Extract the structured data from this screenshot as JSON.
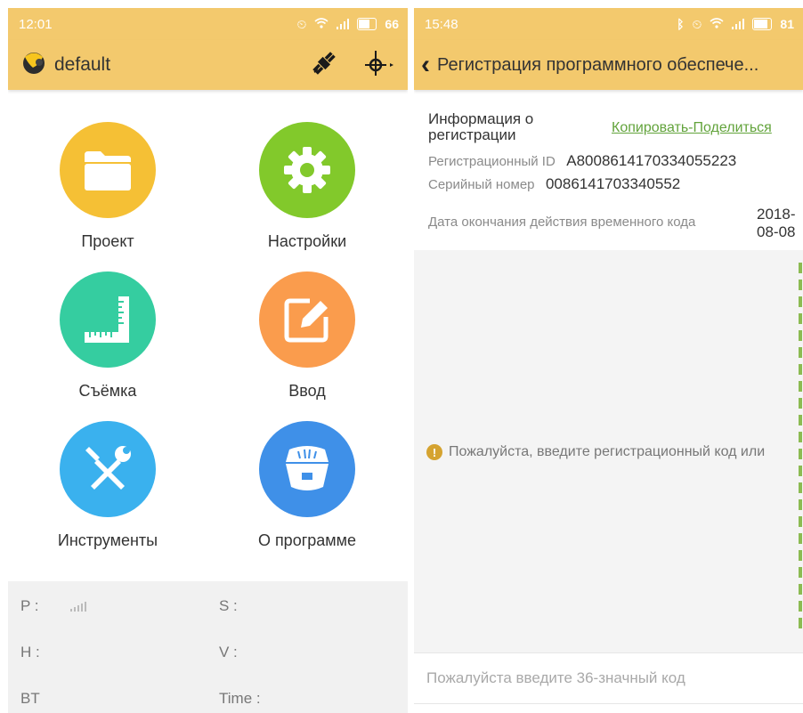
{
  "left_screen": {
    "status": {
      "time": "12:01",
      "battery": "66"
    },
    "app_bar": {
      "title": "default",
      "icons": [
        "satellite-icon",
        "gps-target-icon"
      ]
    },
    "menu": [
      {
        "label": "Проект",
        "icon": "folder-icon",
        "color": "#f5c035"
      },
      {
        "label": "Настройки",
        "icon": "gear-icon",
        "color": "#82c92b"
      },
      {
        "label": "Съёмка",
        "icon": "ruler-survey-icon",
        "color": "#35cda0"
      },
      {
        "label": "Ввод",
        "icon": "edit-icon",
        "color": "#fa9c4d"
      },
      {
        "label": "Инструменты",
        "icon": "tools-icon",
        "color": "#3ab1ee"
      },
      {
        "label": "О программе",
        "icon": "receiver-icon",
        "color": "#3f90e8"
      }
    ],
    "status_panel": {
      "p": "P :",
      "s": "S :",
      "h": "H :",
      "v": "V :",
      "bt": "BT",
      "time": "Time :"
    }
  },
  "right_screen": {
    "status": {
      "time": "15:48",
      "battery": "81"
    },
    "app_bar": {
      "back": "‹",
      "title": "Регистрация программного обеспече..."
    },
    "info": {
      "title": "Информация о регистрации",
      "copy_link": "Копировать-Поделиться",
      "reg_id_label": "Регистрационный ID",
      "reg_id_value": "A8008614170334055223",
      "serial_label": "Серийный номер",
      "serial_value": "0086141703340552",
      "expiry_label": "Дата окончания действия временного кода",
      "expiry_value_1": "2018-",
      "expiry_value_2": "08-08"
    },
    "message": "Пожалуйста, введите регистрационный код или",
    "code_input": {
      "placeholder": "Пожалуйста введите 36-значный код",
      "value": ""
    }
  },
  "colors": {
    "status_bar": "#f3c96d",
    "link_green": "#62a33b",
    "warning": "#d5a330"
  }
}
